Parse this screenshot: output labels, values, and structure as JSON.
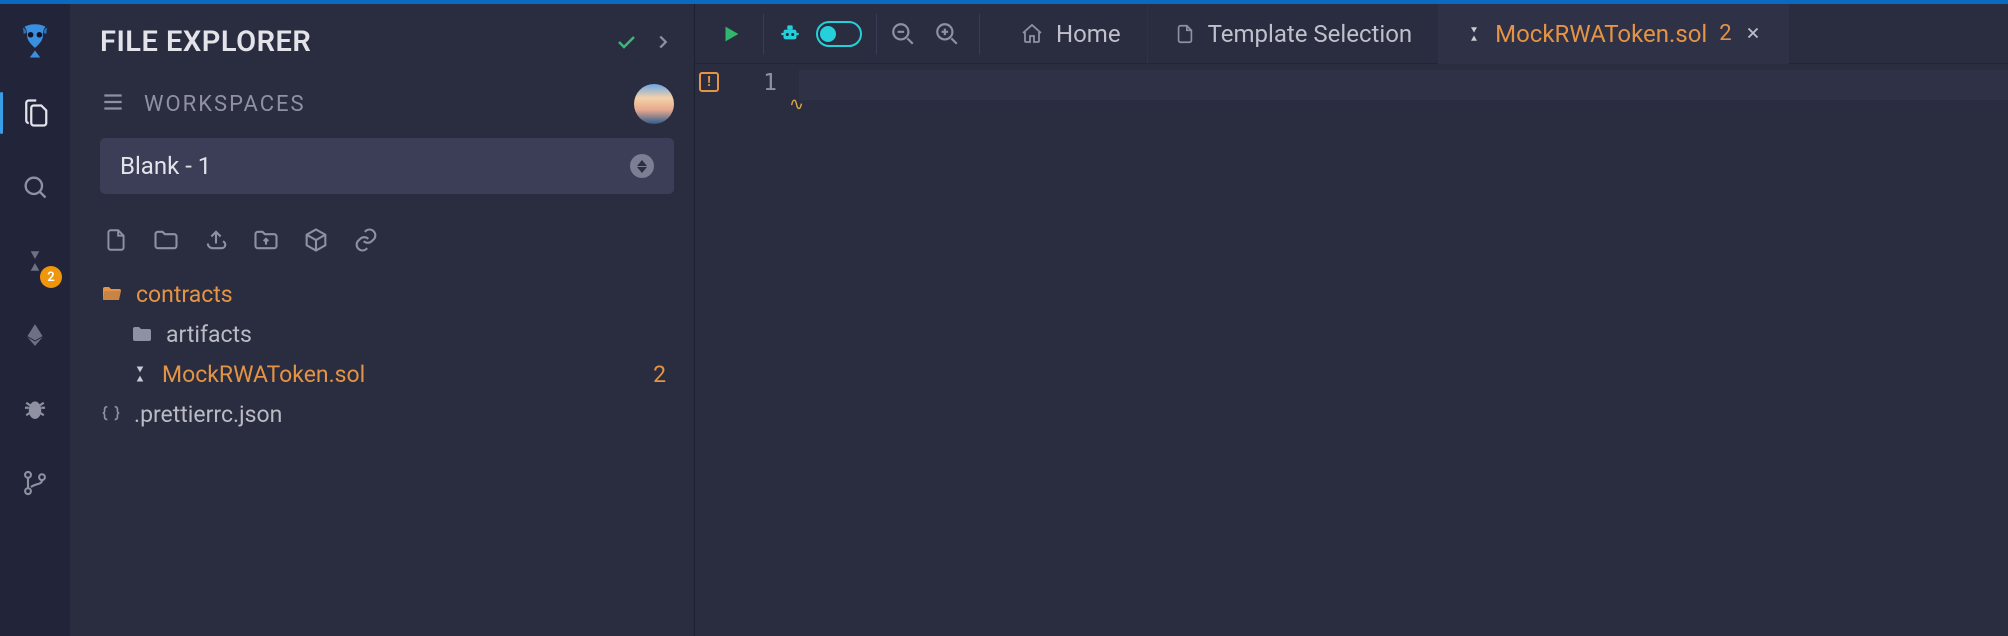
{
  "panel": {
    "title": "FILE EXPLORER",
    "workspaces_label": "WORKSPACES",
    "selected_workspace": "Blank - 1"
  },
  "tree": {
    "contracts_label": "contracts",
    "artifacts_label": "artifacts",
    "mock_file": "MockRWAToken.sol",
    "mock_count": "2",
    "prettier": ".prettierrc.json"
  },
  "rail": {
    "solidity_badge": "2"
  },
  "tabs": {
    "home": "Home",
    "template": "Template Selection",
    "active_file": "MockRWAToken.sol",
    "active_badge": "2"
  },
  "editor": {
    "line1": "1",
    "error_mark": "!"
  }
}
